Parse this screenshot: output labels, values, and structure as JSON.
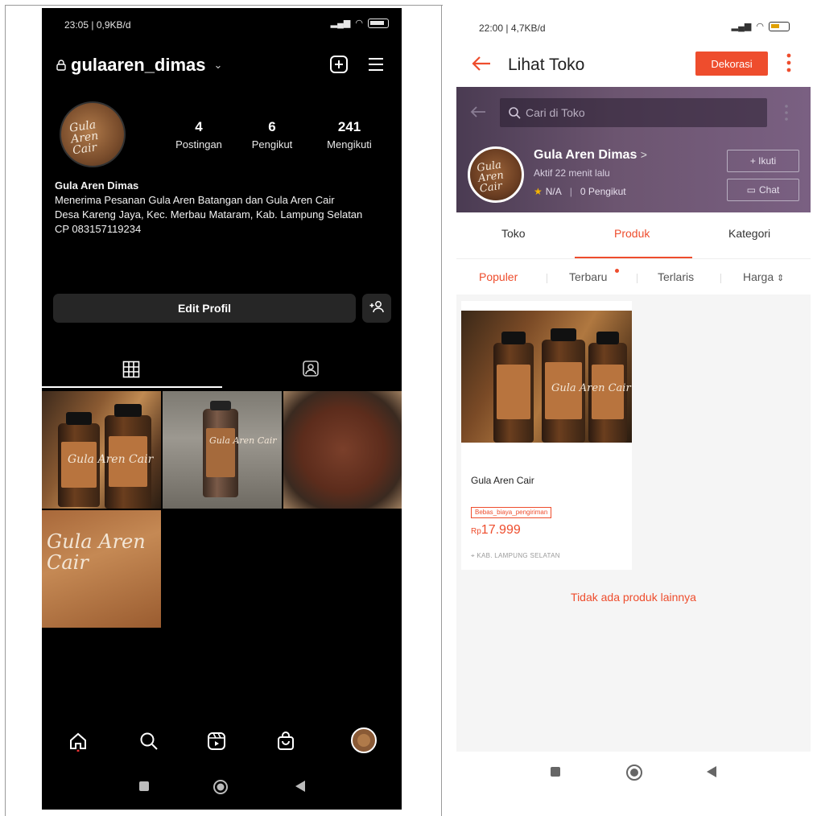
{
  "instagram": {
    "status_time": "23:05 | 0,9KB/d",
    "username": "gulaaren_dimas",
    "stats": [
      {
        "num": "4",
        "label": "Postingan"
      },
      {
        "num": "6",
        "label": "Pengikut"
      },
      {
        "num": "241",
        "label": "Mengikuti"
      }
    ],
    "avatar_text": "Gula Aren Cair",
    "bio": {
      "name": "Gula Aren Dimas",
      "line1": "Menerima Pesanan Gula Aren Batangan dan Gula Aren Cair",
      "line2": "Desa Kareng Jaya, Kec. Merbau Mataram, Kab. Lampung Selatan",
      "line3": "CP 083157119234"
    },
    "edit_profile": "Edit Profil",
    "post_labels": [
      "Gula Aren Cair",
      "Gula Aren Cair",
      "Gula Aren Cair"
    ]
  },
  "shopee": {
    "status_time": "22:00 | 4,7KB/d",
    "title": "Lihat Toko",
    "dekorasi": "Dekorasi",
    "search_placeholder": "Cari di Toko",
    "shop_name": "Gula Aren Dimas",
    "shop_active": "Aktif 22 menit lalu",
    "rating": "N/A",
    "followers": "0 Pengikut",
    "follow_btn": "+ Ikuti",
    "chat_btn": "Chat",
    "logo_text": "Gula Aren Cair",
    "tabs": [
      "Toko",
      "Produk",
      "Kategori"
    ],
    "sort": [
      "Populer",
      "Terbaru",
      "Terlaris",
      "Harga"
    ],
    "product": {
      "name": "Gula Aren Cair",
      "badge": "Bebas_biaya_pengiriman",
      "currency": "Rp",
      "price": "17.999",
      "location": "KAB. LAMPUNG SELATAN"
    },
    "no_more": "Tidak ada produk lainnya"
  }
}
